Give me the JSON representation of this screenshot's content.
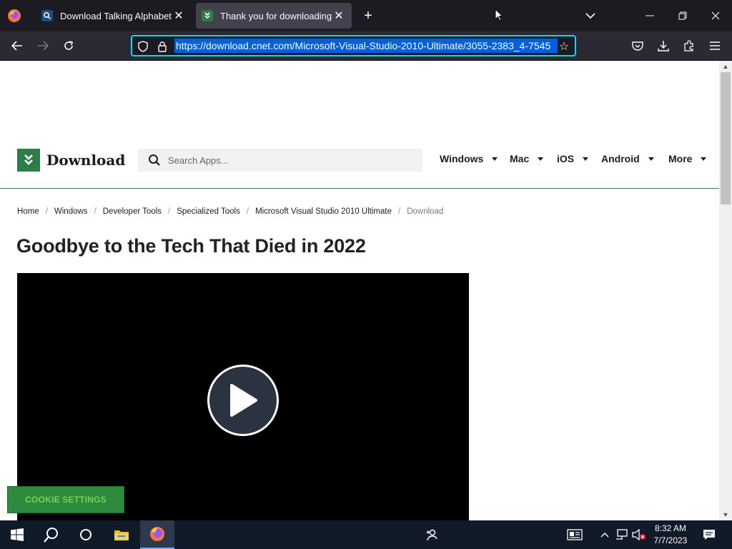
{
  "browser": {
    "tabs": [
      {
        "title": "Download Talking Alphabet by",
        "favicon": "search-favicon"
      },
      {
        "title": "Thank you for downloading Mi",
        "favicon": "download-favicon",
        "active": true
      }
    ],
    "url": "https://download.cnet.com/Microsoft-Visual-Studio-2010-Ultimate/3055-2383_4-7545"
  },
  "site": {
    "logo_text": "Download",
    "search_placeholder": "Search Apps...",
    "nav": [
      "Windows",
      "Mac",
      "iOS",
      "Android",
      "More"
    ]
  },
  "breadcrumb": [
    "Home",
    "Windows",
    "Developer Tools",
    "Specialized Tools",
    "Microsoft Visual Studio 2010 Ultimate",
    "Download"
  ],
  "headline": "Goodbye to the Tech That Died in 2022",
  "cookie_label": "COOKIE SETTINGS",
  "taskbar": {
    "time": "8:32 AM",
    "date": "7/7/2023"
  },
  "colors": {
    "brand_green": "#2e7d46",
    "url_highlight": "#0060df",
    "url_focus_ring": "#00ddff"
  }
}
